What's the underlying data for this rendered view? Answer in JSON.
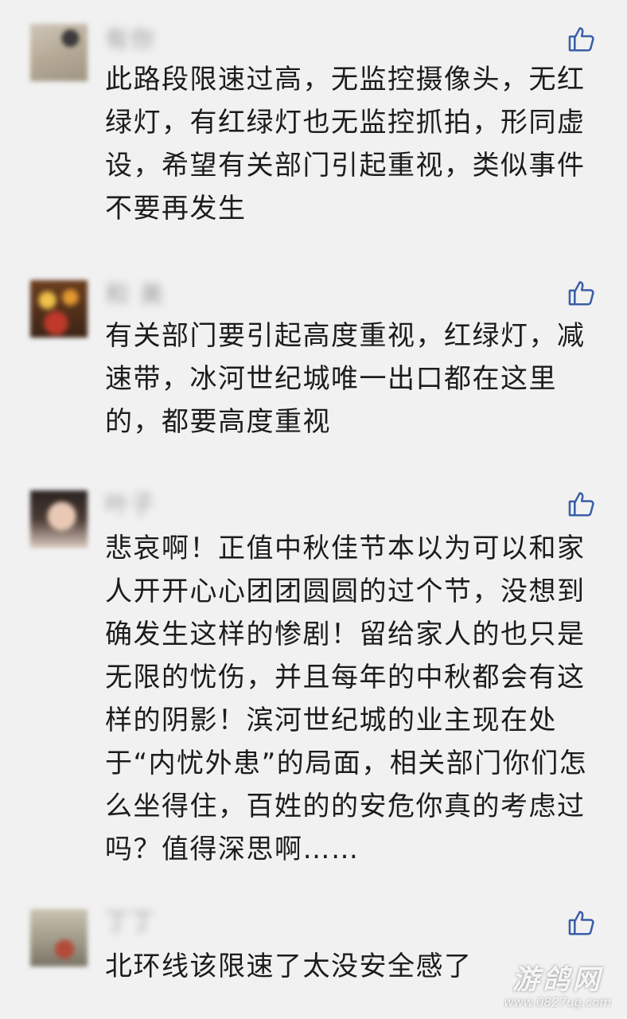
{
  "colors": {
    "background": "#f1f1f1",
    "text": "#1c1c1c",
    "like_icon": "#3b5ea8"
  },
  "comments": [
    {
      "name": "有你",
      "text": "此路段限速过高，无监控摄像头，无红绿灯，有红绿灯也无监控抓拍，形同虚设，希望有关部门引起重视，类似事件不要再发生",
      "icon": "thumbs-up-icon"
    },
    {
      "name": "和 美",
      "text": "有关部门要引起高度重视，红绿灯，减速带，冰河世纪城唯一出口都在这里的，都要高度重视",
      "icon": "thumbs-up-icon"
    },
    {
      "name": "叶子",
      "text": "悲哀啊！正值中秋佳节本以为可以和家人开开心心团团圆圆的过个节，没想到确发生这样的惨剧！留给家人的也只是无限的忧伤，并且每年的中秋都会有这样的阴影！滨河世纪城的业主现在处于“内忧外患”的局面，相关部门你们怎么坐得住，百姓的的安危你真的考虑过吗？值得深思啊……",
      "icon": "thumbs-up-icon"
    },
    {
      "name": "丁丁",
      "text": "北环线该限速了太没安全感了",
      "icon": "thumbs-up-icon"
    }
  ],
  "watermark": {
    "title": "游鸽网",
    "url": "www.0827ug.com"
  }
}
